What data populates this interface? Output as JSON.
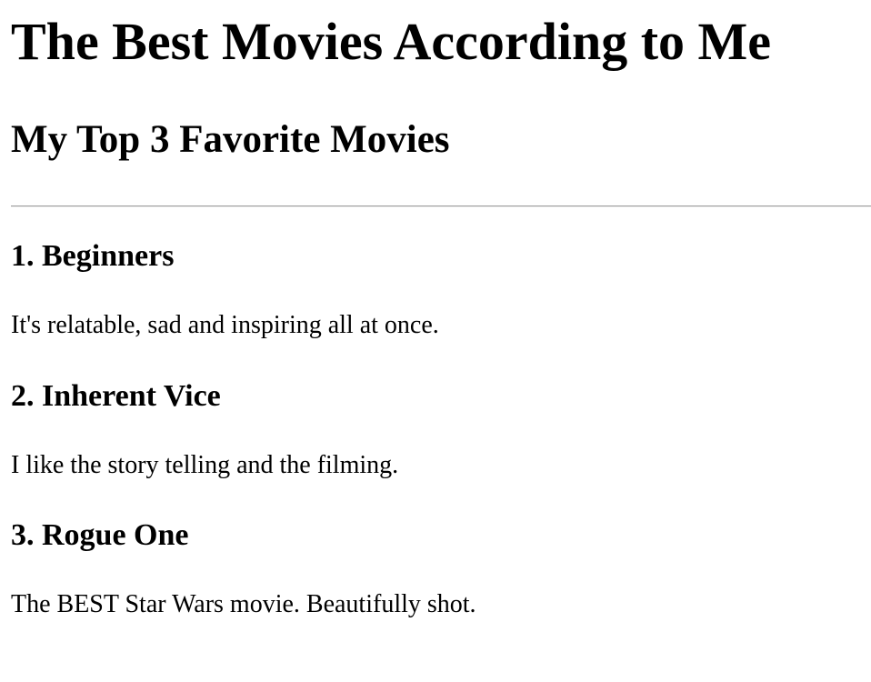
{
  "page": {
    "title": "The Best Movies According to Me",
    "subtitle": "My Top 3 Favorite Movies"
  },
  "movies": [
    {
      "heading": "1. Beginners",
      "description": "It's relatable, sad and inspiring all at once."
    },
    {
      "heading": "2. Inherent Vice",
      "description": "I like the story telling and the filming."
    },
    {
      "heading": "3. Rogue One",
      "description": "The BEST Star Wars movie. Beautifully shot."
    }
  ]
}
